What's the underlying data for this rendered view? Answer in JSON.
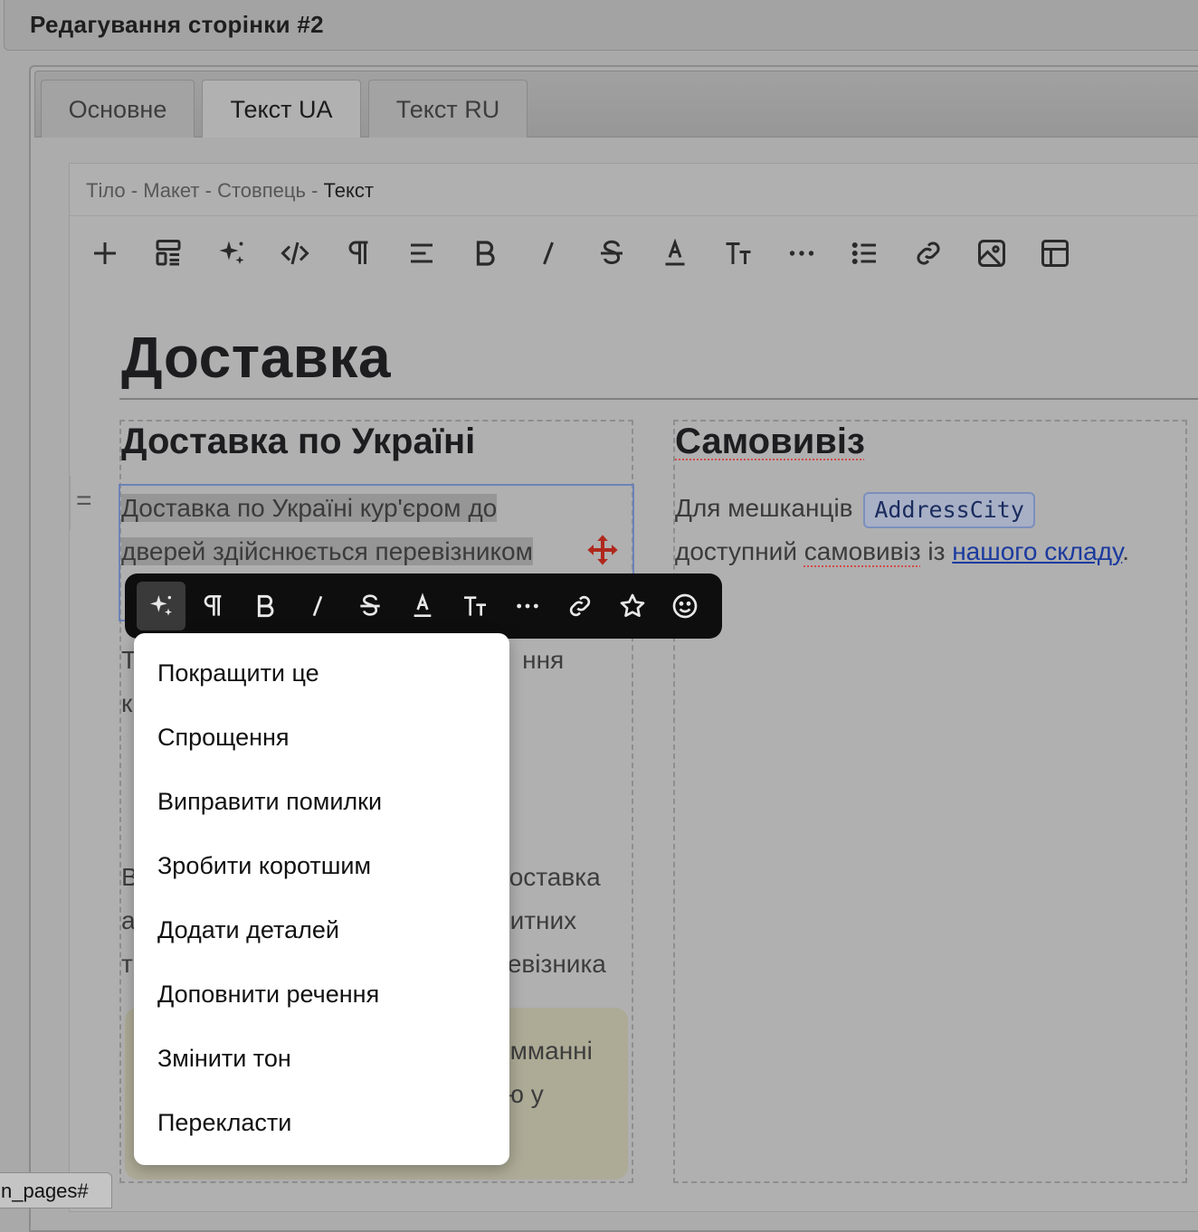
{
  "window": {
    "title": "Редагування сторінки #2"
  },
  "tabs": [
    {
      "label": "Основне"
    },
    {
      "label": "Текст UA"
    },
    {
      "label": "Текст RU"
    }
  ],
  "breadcrumb": {
    "items": [
      "Тіло",
      "Макет",
      "Стовпець"
    ],
    "separator": "-",
    "current": "Текст"
  },
  "toolbar": {
    "icons": [
      "plus-icon",
      "layout-icon",
      "sparkles-icon",
      "code-icon",
      "paragraph-icon",
      "align-icon",
      "bold-icon",
      "italic-icon",
      "strikethrough-icon",
      "font-color-icon",
      "text-size-icon",
      "more-icon",
      "list-icon",
      "link-icon",
      "image-icon",
      "table-icon"
    ]
  },
  "content": {
    "heading": "Доставка",
    "col1": {
      "heading": "Доставка по Україні",
      "selected_paragraph": {
        "line1": "Доставка по Україні кур'єром до",
        "line2": "дверей здійснюється перевізником"
      },
      "p2_fragment": {
        "start": "Т",
        "end": "ння",
        "line2_start": "к"
      },
      "p3_fragment": {
        "l1_start": "В",
        "l1_end": "оставка",
        "l2_start": "а",
        "l2_end": "итних",
        "l3_start": "т",
        "l3_end": "евізника"
      },
      "notice_fragment": {
        "l1_end": "имманні",
        "l2_end": "ю у"
      }
    },
    "col2": {
      "heading": "Самовивіз",
      "p_text1": "Для мешканців",
      "chip": "AddressCity",
      "p_text2_a": "доступний",
      "p_text2_b": "самовивіз",
      "p_text2_c": "із",
      "link": "нашого складу",
      "p_end": "."
    }
  },
  "format_toolbar": {
    "icons": [
      "sparkles-icon",
      "paragraph-icon",
      "bold-icon",
      "italic-icon",
      "strikethrough-icon",
      "font-color-icon",
      "text-size-icon",
      "more-icon",
      "link-icon",
      "star-icon",
      "emoji-icon"
    ],
    "active": "sparkles-icon"
  },
  "ai_menu": {
    "items": [
      "Покращити це",
      "Спрощення",
      "Виправити помилки",
      "Зробити коротшим",
      "Додати деталей",
      "Доповнити речення",
      "Змінити тон",
      "Перекласти"
    ]
  },
  "status_bar": {
    "url_fragment": "n_pages#"
  },
  "colors": {
    "overlay": "#a9a9a9",
    "format_toolbar_bg": "#0e0e0e",
    "menu_bg": "#ffffff",
    "link": "#1b3a9e",
    "chip_border": "#7b8fbd",
    "move_icon": "#b0281c"
  }
}
